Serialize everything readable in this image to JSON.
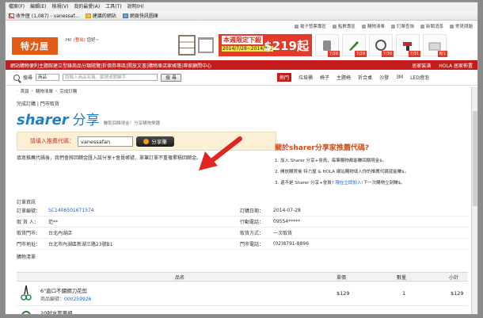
{
  "browser": {
    "menu": [
      "檔案(F)",
      "編輯(E)",
      "檢視(V)",
      "我的最愛(A)",
      "工具(T)",
      "說明(H)"
    ],
    "favorites": [
      {
        "icon": "gmail-icon",
        "label": "收件匣 (1,087) - vanessaf..."
      },
      {
        "icon": "folder-icon",
        "label": "建議的網站"
      },
      {
        "icon": "web-slice-icon",
        "label": "網頁快訊圖庫"
      }
    ]
  },
  "site": {
    "toplinks": [
      "電子發票專區",
      "點數專區",
      "購物清單",
      "訂單查詢",
      "新聞消息",
      "常見問題"
    ],
    "logo": "特力屋",
    "greeting_prefix": "Hi!",
    "greeting_link": "(登出)",
    "greeting_suffix": "您好~",
    "banner": {
      "headline": "本週限定下殺",
      "dates": "2014/7/28~2014/8/3",
      "price": "$219起",
      "tiles": [
        "7/28",
        "7/29",
        "7/30",
        "7/31",
        "8/1"
      ]
    },
    "notice": "網站購物便利主題館建立型錄商品分類隨覽|折價券專區|開放文書|購物車店家帳篷|專家顧問中心",
    "notice_right": [
      "居家裝潢",
      "HOLA 居家佈置"
    ],
    "search": {
      "label": "搜尋",
      "select": "商品",
      "placeholder": "請輸入商品名稱、編號或關鍵字",
      "button": "搜 尋"
    },
    "hot": {
      "label": "熱門",
      "items": [
        "垃圾桶",
        "椅子",
        "主題椅",
        "折合桌",
        "沙發",
        "3M",
        "LED燈泡"
      ]
    }
  },
  "breadcrumb": [
    "首頁",
    "購物清單",
    "完成訂購"
  ],
  "page": {
    "title": "完成訂購 | 門市取貨",
    "sharer_brand": "sharer",
    "sharer_brand_cn": "分享",
    "sharer_tag": "賺取回饋現金！分享購物樂趣",
    "code_label": "請填入推薦代碼：",
    "code_value": "vanessafan",
    "share_button": "分享賺",
    "hint": "填寫推薦代碼後，我們會將回饋金匯入該分享+會員帳號，單筆訂單不重複累積回饋金。"
  },
  "aside": {
    "title": "關於sharer分享家推薦代碼?",
    "lines": [
      {
        "text": "1. 加入 Sharer 分享+會員，每筆購物都能賺回饋現金$。"
      },
      {
        "text": "2. 開放購買後 特力屋 & HOLA 網站購物填入你的推薦代碼就能賺$。"
      },
      {
        "text_a": "3. 還不是 Sharer 分享+會員? ",
        "link": "現在立即加入!",
        "text_b": "下一次購物立刻賺$。"
      }
    ]
  },
  "order": {
    "section_label": "訂單資訊",
    "rows": [
      {
        "k1": "訂單編號：",
        "v1": "SC1406501671574",
        "k2": "訂購日期：",
        "v2": "2014-07-28"
      },
      {
        "k1": "取 貨 人：",
        "v1": "范**",
        "k2": "行動電話：",
        "v2": "09554*****"
      },
      {
        "k1": "取貨門市：",
        "v1": "台北內湖店",
        "k2": "取貨方式：",
        "v2": "一次取貨"
      },
      {
        "k1": "門市地址：",
        "v1": "台北市內湖區新湖三路23號B1",
        "k2": "門市電話：",
        "v2": "(02)8791-8896"
      }
    ]
  },
  "items": {
    "section_label": "購物清單",
    "headers": [
      "品名",
      "單價",
      "數量",
      "小計"
    ],
    "rows": [
      {
        "name": "6\"直口不鏽鋼刀花剪",
        "no_label": "商品編號：",
        "no": "000259926",
        "price": "$129",
        "qty": "1",
        "subtotal": "$129"
      },
      {
        "name": "20吋水管車組",
        "no_label": "",
        "no": "",
        "price": "",
        "qty": "",
        "subtotal": ""
      }
    ]
  },
  "colors": {
    "brand": "#e35b18",
    "notice": "#c21c1c",
    "link": "#1f5fbf",
    "arrow": "#e0261e"
  }
}
